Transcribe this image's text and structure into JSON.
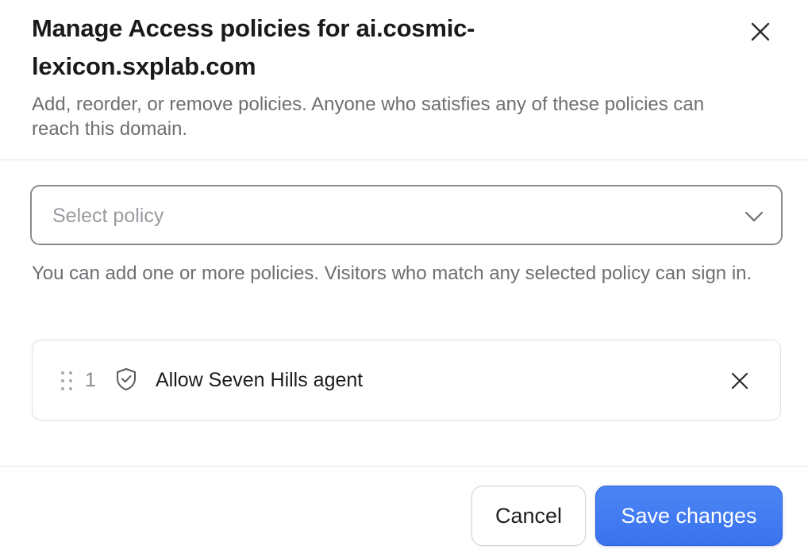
{
  "dialog": {
    "title": "Manage Access policies for ai.cosmic-lexicon.sxplab.com",
    "subtitle": "Add, reorder, or remove policies. Anyone who satisfies any of these policies can reach this domain.",
    "close_icon": "close-icon"
  },
  "policy_select": {
    "placeholder": "Select policy",
    "chevron_icon": "chevron-down-icon",
    "helper_text": "You can add one or more policies. Visitors who match any selected policy can sign in."
  },
  "policies": [
    {
      "index": "1",
      "name": "Allow Seven Hills agent",
      "handle_icon": "drag-handle-icon",
      "type_icon": "shield-check-icon",
      "remove_icon": "close-icon"
    }
  ],
  "footer": {
    "cancel_label": "Cancel",
    "save_label": "Save changes"
  },
  "colors": {
    "primary": "#3a72ee",
    "text": "#1d1d1f",
    "muted_text": "#6e6e73",
    "placeholder": "#9a9aa0",
    "border": "#dedee2"
  }
}
